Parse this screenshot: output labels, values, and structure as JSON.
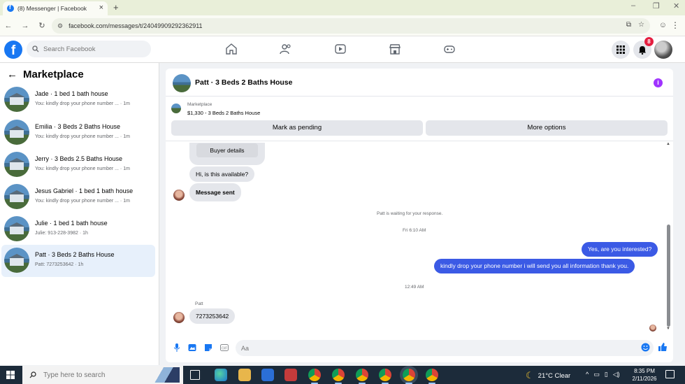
{
  "browser": {
    "tab_title": "(8) Messenger | Facebook",
    "url": "facebook.com/messages/t/24049909292362911"
  },
  "fb": {
    "search_placeholder": "Search Facebook",
    "notification_count": "8"
  },
  "sidebar": {
    "title": "Marketplace",
    "conversations": [
      {
        "name": "Jade · 1 bed 1 bath house",
        "preview": "You: kindly drop your phone number ... · 1m"
      },
      {
        "name": "Emilia · 3 Beds 2 Baths House",
        "preview": "You: kindly drop your phone number ... · 1m"
      },
      {
        "name": "Jerry · 3 Beds 2.5 Baths House",
        "preview": "You: kindly drop your phone number ... · 1m"
      },
      {
        "name": "Jesus Gabriel · 1 bed 1 bath house",
        "preview": "You: kindly drop your phone number ... · 1m"
      },
      {
        "name": "Julie · 1 bed 1 bath house",
        "preview": "Julie: 913-228-3982 · 1h"
      },
      {
        "name": "Patt · 3 Beds 2 Baths House",
        "preview": "Patt: 7273253642 · 1h"
      }
    ]
  },
  "chat": {
    "title": "Patt · 3 Beds 2 Baths House",
    "marketplace_label": "Marketplace",
    "listing_detail": "$1,330 - 3 Beds 2 Baths House",
    "mark_pending": "Mark as pending",
    "more_options": "More options",
    "buyer_details": "Buyer details",
    "msg_available": "Hi, is this available?",
    "msg_sent": "Message sent",
    "waiting": "Patt is waiting for your response.",
    "time1": "Fri 6:10 AM",
    "out1": "Yes, are you interested?",
    "out2": "kindly drop your phone number i will send you all information thank you.",
    "time2": "12:49 AM",
    "sender_patt": "Patt",
    "in_phone": "7273253642",
    "composer_placeholder": "Aa"
  },
  "taskbar": {
    "search_placeholder": "Type here to search",
    "weather": "21°C  Clear",
    "time": "8:35 PM",
    "date": "2/11/2026"
  }
}
